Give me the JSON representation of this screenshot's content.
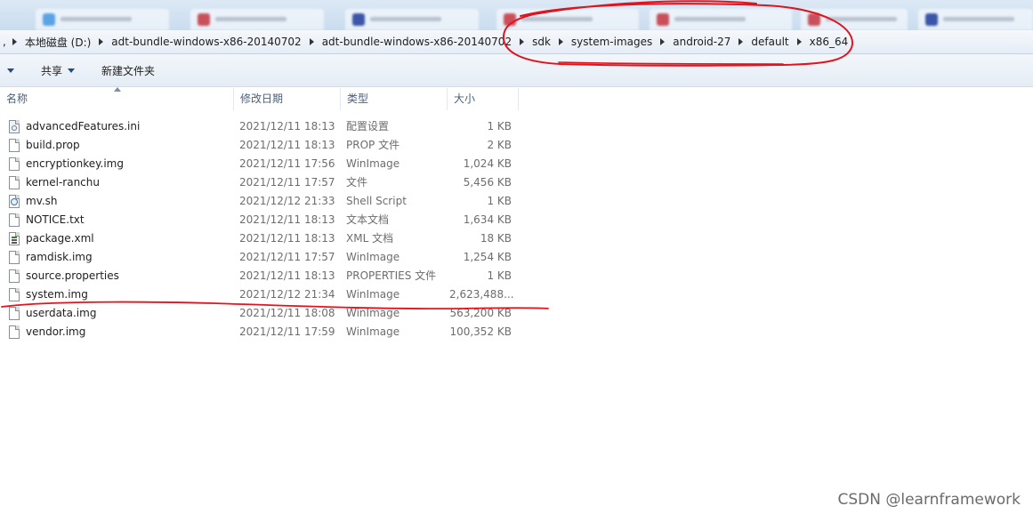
{
  "address_bar": {
    "crumbs": [
      "本地磁盘 (D:)",
      "adt-bundle-windows-x86-20140702",
      "adt-bundle-windows-x86-20140702",
      "sdk",
      "system-images",
      "android-27",
      "default",
      "x86_64"
    ]
  },
  "toolbar": {
    "share_label": "共享",
    "new_folder_label": "新建文件夹"
  },
  "columns": {
    "name": "名称",
    "modified": "修改日期",
    "type": "类型",
    "size": "大小"
  },
  "files": [
    {
      "name": "advancedFeatures.ini",
      "modified": "2021/12/11 18:13",
      "type": "配置设置",
      "size": "1 KB",
      "icon": "settings-file-icon"
    },
    {
      "name": "build.prop",
      "modified": "2021/12/11 18:13",
      "type": "PROP 文件",
      "size": "2 KB",
      "icon": "file-icon"
    },
    {
      "name": "encryptionkey.img",
      "modified": "2021/12/11 17:56",
      "type": "WinImage",
      "size": "1,024 KB",
      "icon": "file-icon"
    },
    {
      "name": "kernel-ranchu",
      "modified": "2021/12/11 17:57",
      "type": "文件",
      "size": "5,456 KB",
      "icon": "file-icon"
    },
    {
      "name": "mv.sh",
      "modified": "2021/12/12 21:33",
      "type": "Shell Script",
      "size": "1 KB",
      "icon": "script-file-icon"
    },
    {
      "name": "NOTICE.txt",
      "modified": "2021/12/11 18:13",
      "type": "文本文档",
      "size": "1,634 KB",
      "icon": "text-file-icon"
    },
    {
      "name": "package.xml",
      "modified": "2021/12/11 18:13",
      "type": "XML 文档",
      "size": "18 KB",
      "icon": "xml-file-icon"
    },
    {
      "name": "ramdisk.img",
      "modified": "2021/12/11 17:57",
      "type": "WinImage",
      "size": "1,254 KB",
      "icon": "file-icon"
    },
    {
      "name": "source.properties",
      "modified": "2021/12/11 18:13",
      "type": "PROPERTIES 文件",
      "size": "1 KB",
      "icon": "file-icon"
    },
    {
      "name": "system.img",
      "modified": "2021/12/12 21:34",
      "type": "WinImage",
      "size": "2,623,488...",
      "icon": "file-icon"
    },
    {
      "name": "userdata.img",
      "modified": "2021/12/11 18:08",
      "type": "WinImage",
      "size": "563,200 KB",
      "icon": "file-icon"
    },
    {
      "name": "vendor.img",
      "modified": "2021/12/11 17:59",
      "type": "WinImage",
      "size": "100,352 KB",
      "icon": "file-icon"
    }
  ],
  "watermark": "CSDN @learnframework",
  "colors": {
    "annotation": "#e0141e",
    "toolbar_bg": "#e8eff7"
  }
}
